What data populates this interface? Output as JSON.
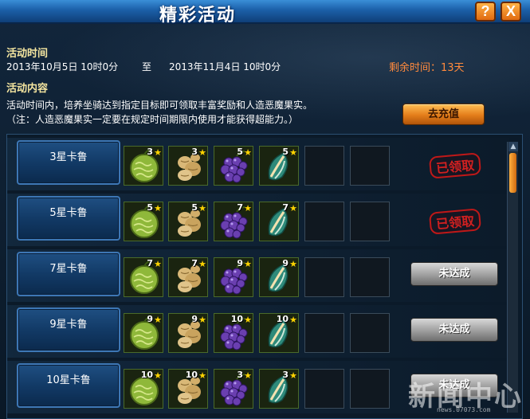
{
  "window": {
    "title": "精彩活动",
    "help_label": "?",
    "close_label": "X"
  },
  "info": {
    "time_heading": "活动时间",
    "start": "2013年10月5日  10时0分",
    "to": "至",
    "end": "2013年11月4日  10时0分",
    "remaining": "剩余时间：13天",
    "content_heading": "活动内容",
    "desc_line1": "活动时间内，培养坐骑达到指定目标即可领取丰富奖励和人造恶魔果实。",
    "desc_line2": "（注：人造恶魔果实一定要在规定时间期限内使用才能获得超能力。）",
    "recharge_label": "去充值"
  },
  "rewards": [
    {
      "level": "3星卡鲁",
      "items": [
        {
          "icon": "green-fruit-icon",
          "count": "3"
        },
        {
          "icon": "ginger-root-icon",
          "count": "3"
        },
        {
          "icon": "grape-icon",
          "count": "5"
        },
        {
          "icon": "leaf-bulb-icon",
          "count": "5"
        }
      ],
      "status": "claimed",
      "status_label": "已领取"
    },
    {
      "level": "5星卡鲁",
      "items": [
        {
          "icon": "green-fruit-icon",
          "count": "5"
        },
        {
          "icon": "ginger-root-icon",
          "count": "5"
        },
        {
          "icon": "grape-icon",
          "count": "7"
        },
        {
          "icon": "leaf-bulb-icon",
          "count": "7"
        }
      ],
      "status": "claimed",
      "status_label": "已领取"
    },
    {
      "level": "7星卡鲁",
      "items": [
        {
          "icon": "green-fruit-icon",
          "count": "7"
        },
        {
          "icon": "ginger-root-icon",
          "count": "7"
        },
        {
          "icon": "grape-icon",
          "count": "9"
        },
        {
          "icon": "leaf-bulb-icon",
          "count": "9"
        }
      ],
      "status": "unachieved",
      "status_label": "未达成"
    },
    {
      "level": "9星卡鲁",
      "items": [
        {
          "icon": "green-fruit-icon",
          "count": "9"
        },
        {
          "icon": "ginger-root-icon",
          "count": "9"
        },
        {
          "icon": "grape-icon",
          "count": "10"
        },
        {
          "icon": "leaf-bulb-icon",
          "count": "10"
        }
      ],
      "status": "unachieved",
      "status_label": "未达成"
    },
    {
      "level": "10星卡鲁",
      "items": [
        {
          "icon": "green-fruit-icon",
          "count": "10"
        },
        {
          "icon": "ginger-root-icon",
          "count": "10"
        },
        {
          "icon": "grape-icon",
          "count": "3"
        },
        {
          "icon": "leaf-bulb-icon",
          "count": "3"
        }
      ],
      "status": "unachieved",
      "status_label": "未达成"
    }
  ],
  "watermark": {
    "main": "新闻中心",
    "sub": "news.07073.com"
  },
  "colors": {
    "accent": "#ff8a3d",
    "title_bar": "#1b5fa8",
    "stamp_red": "#d02020"
  }
}
